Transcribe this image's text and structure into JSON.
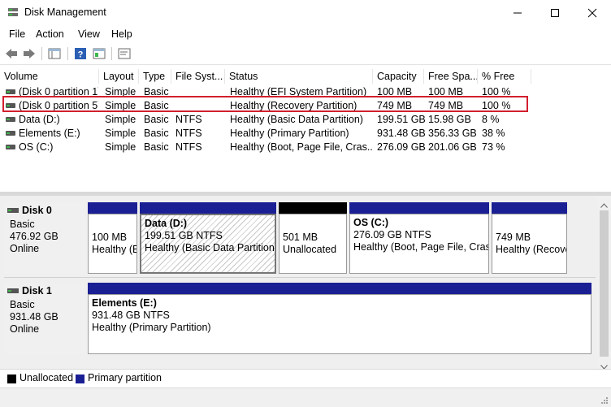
{
  "window": {
    "title": "Disk Management",
    "minimize_icon": "minimize-icon",
    "maximize_icon": "maximize-icon",
    "close_icon": "close-icon"
  },
  "menu": {
    "items": [
      {
        "label": "File"
      },
      {
        "label": "Action"
      },
      {
        "label": "View"
      },
      {
        "label": "Help"
      }
    ]
  },
  "toolbar": {
    "buttons": [
      "back-icon",
      "forward-icon",
      "show-hide-pane-icon",
      "help-icon",
      "properties-icon",
      "console-icon"
    ]
  },
  "volume_list": {
    "columns": [
      "Volume",
      "Layout",
      "Type",
      "File Syst...",
      "Status",
      "Capacity",
      "Free Spa...",
      "% Free"
    ],
    "rows": [
      {
        "volume": "(Disk 0 partition 1)",
        "layout": "Simple",
        "type": "Basic",
        "fs": "",
        "status": "Healthy (EFI System Partition)",
        "capacity": "100 MB",
        "free": "100 MB",
        "pct": "100 %"
      },
      {
        "volume": "(Disk 0 partition 5)",
        "layout": "Simple",
        "type": "Basic",
        "fs": "",
        "status": "Healthy (Recovery Partition)",
        "capacity": "749 MB",
        "free": "749 MB",
        "pct": "100 %"
      },
      {
        "volume": "Data (D:)",
        "layout": "Simple",
        "type": "Basic",
        "fs": "NTFS",
        "status": "Healthy (Basic Data Partition)",
        "capacity": "199.51 GB",
        "free": "15.98 GB",
        "pct": "8 %"
      },
      {
        "volume": "Elements (E:)",
        "layout": "Simple",
        "type": "Basic",
        "fs": "NTFS",
        "status": "Healthy (Primary Partition)",
        "capacity": "931.48 GB",
        "free": "356.33 GB",
        "pct": "38 %"
      },
      {
        "volume": "OS (C:)",
        "layout": "Simple",
        "type": "Basic",
        "fs": "NTFS",
        "status": "Healthy (Boot, Page File, Cras...",
        "capacity": "276.09 GB",
        "free": "201.06 GB",
        "pct": "73 %"
      }
    ]
  },
  "disks": [
    {
      "name": "Disk 0",
      "type": "Basic",
      "size": "476.92 GB",
      "state": "Online",
      "partitions": [
        {
          "name": "",
          "line1": "100 MB",
          "line2": "Healthy (EFI System Partition)",
          "kind": "primary"
        },
        {
          "name": "Data  (D:)",
          "line1": "199.51 GB NTFS",
          "line2": "Healthy (Basic Data Partition)",
          "kind": "primary-selected"
        },
        {
          "name": "",
          "line1": "501 MB",
          "line2": "Unallocated",
          "kind": "unallocated"
        },
        {
          "name": "OS  (C:)",
          "line1": "276.09 GB NTFS",
          "line2": "Healthy (Boot, Page File, Crash Dump, Basic Data Partition)",
          "kind": "primary"
        },
        {
          "name": "",
          "line1": "749 MB",
          "line2": "Healthy (Recovery Partition)",
          "kind": "primary"
        }
      ]
    },
    {
      "name": "Disk 1",
      "type": "Basic",
      "size": "931.48 GB",
      "state": "Online",
      "partitions": [
        {
          "name": "Elements  (E:)",
          "line1": "931.48 GB NTFS",
          "line2": "Healthy (Primary Partition)",
          "kind": "primary"
        }
      ]
    }
  ],
  "legend": [
    {
      "label": "Unallocated",
      "color": "#000000"
    },
    {
      "label": "Primary partition",
      "color": "#1a1f94"
    }
  ]
}
